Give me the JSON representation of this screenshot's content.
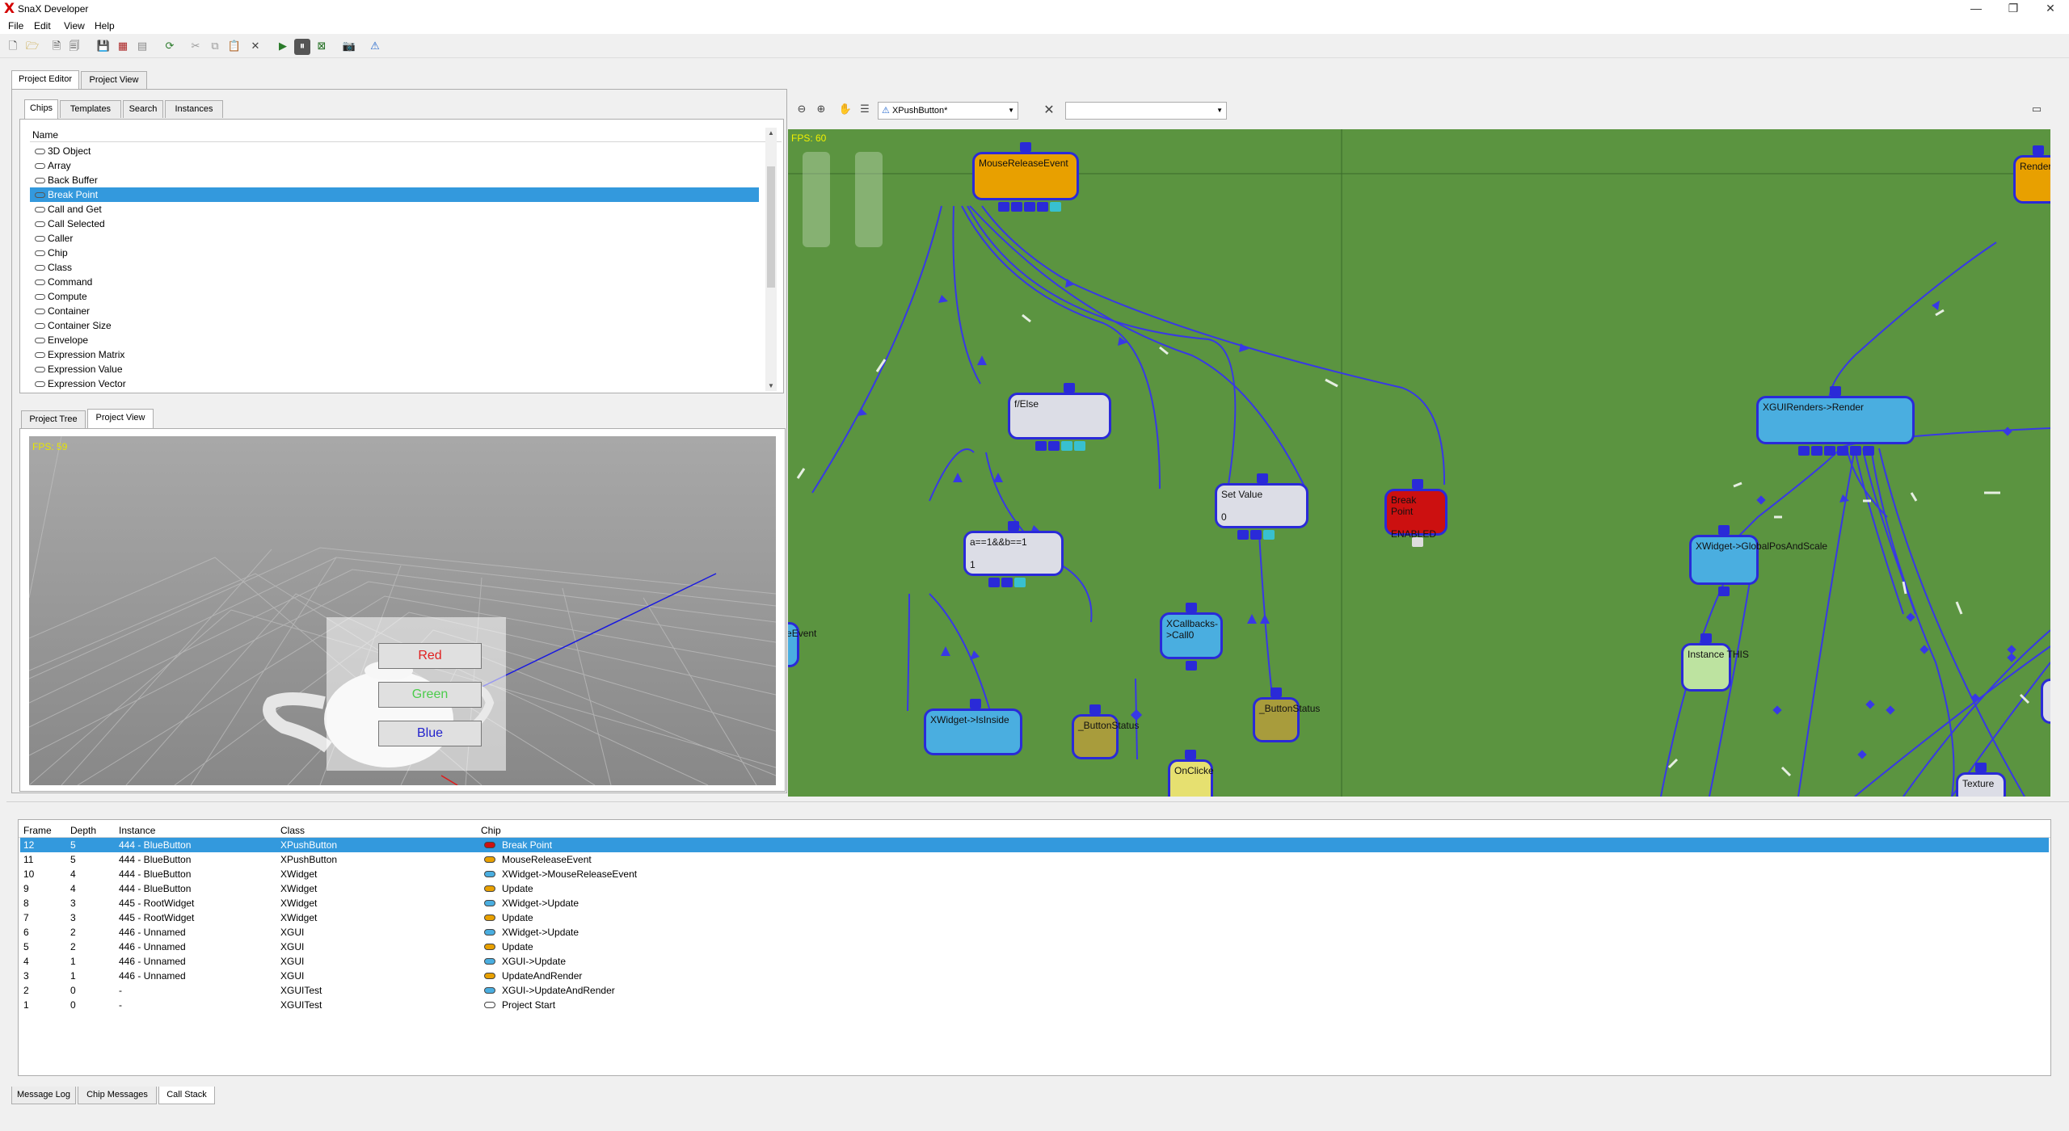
{
  "window": {
    "title": "SnaX Developer",
    "minimize": "—",
    "restore": "❐",
    "close": "✕"
  },
  "menu": [
    "File",
    "Edit",
    "View",
    "Help"
  ],
  "top_tabs": {
    "editor": "Project Editor",
    "view": "Project View"
  },
  "chips_tabs": [
    "Chips",
    "Templates",
    "Search",
    "Instances"
  ],
  "chips_list": {
    "header": "Name",
    "items": [
      "3D Object",
      "Array",
      "Back Buffer",
      "Break Point",
      "Call and Get",
      "Call Selected",
      "Caller",
      "Chip",
      "Class",
      "Command",
      "Compute",
      "Container",
      "Container Size",
      "Envelope",
      "Expression Matrix",
      "Expression Value",
      "Expression Vector"
    ],
    "selected": 3
  },
  "project_tabs": {
    "tree": "Project Tree",
    "view": "Project View"
  },
  "viewport": {
    "fps": "FPS: 59",
    "buttons": [
      {
        "label": "Red",
        "color": "#e02020"
      },
      {
        "label": "Green",
        "color": "#4ccc4c"
      },
      {
        "label": "Blue",
        "color": "#2222cc"
      }
    ]
  },
  "graph_toolbar": {
    "class_select": "XPushButton*",
    "second_select": ""
  },
  "graph": {
    "fps": "FPS: 60",
    "nodes": {
      "mre": "MouseReleaseEvent",
      "ifelse": "f/Else",
      "setvalue": "Set Value",
      "setvalue_val": "0",
      "bp": "Break Point",
      "bp_val": "ENABLED",
      "expr": "a==1&&b==1",
      "expr_val": "1",
      "callbacks": "XCallbacks->Call0",
      "isinside": "XWidget->IsInside",
      "bstatus1": "_ButtonStatus",
      "bstatus2": "_ButtonStatus",
      "onclicked": "OnClicke",
      "leftcut": "seReleaseEvent",
      "xguirender": "XGUIRenders->Render",
      "globalpos": "XWidget->GlobalPosAndScale",
      "instance": "Instance",
      "this": "THIS",
      "texture": "Texture",
      "render": "Render"
    }
  },
  "callstack": {
    "columns": [
      "Frame",
      "Depth",
      "Instance",
      "Class",
      "Chip"
    ],
    "rows": [
      {
        "frame": "12",
        "depth": "5",
        "instance": "444 - BlueButton",
        "class": "XPushButton",
        "chip": "Break Point",
        "icon": "red"
      },
      {
        "frame": "11",
        "depth": "5",
        "instance": "444 - BlueButton",
        "class": "XPushButton",
        "chip": "MouseReleaseEvent",
        "icon": "orange"
      },
      {
        "frame": "10",
        "depth": "4",
        "instance": "444 - BlueButton",
        "class": "XWidget",
        "chip": "XWidget->MouseReleaseEvent",
        "icon": "blue"
      },
      {
        "frame": "9",
        "depth": "4",
        "instance": "444 - BlueButton",
        "class": "XWidget",
        "chip": "Update",
        "icon": "orange"
      },
      {
        "frame": "8",
        "depth": "3",
        "instance": "445 - RootWidget",
        "class": "XWidget",
        "chip": "XWidget->Update",
        "icon": "blue"
      },
      {
        "frame": "7",
        "depth": "3",
        "instance": "445 - RootWidget",
        "class": "XWidget",
        "chip": "Update",
        "icon": "orange"
      },
      {
        "frame": "6",
        "depth": "2",
        "instance": "446 - Unnamed",
        "class": "XGUI",
        "chip": "XWidget->Update",
        "icon": "blue"
      },
      {
        "frame": "5",
        "depth": "2",
        "instance": "446 - Unnamed",
        "class": "XGUI",
        "chip": "Update",
        "icon": "orange"
      },
      {
        "frame": "4",
        "depth": "1",
        "instance": "446 - Unnamed",
        "class": "XGUI",
        "chip": "XGUI->Update",
        "icon": "blue"
      },
      {
        "frame": "3",
        "depth": "1",
        "instance": "446 - Unnamed",
        "class": "XGUI",
        "chip": "UpdateAndRender",
        "icon": "orange"
      },
      {
        "frame": "2",
        "depth": "0",
        "instance": "-",
        "class": "XGUITest",
        "chip": "XGUI->UpdateAndRender",
        "icon": "blue"
      },
      {
        "frame": "1",
        "depth": "0",
        "instance": "-",
        "class": "XGUITest",
        "chip": "Project Start",
        "icon": "white"
      }
    ],
    "selected": 0
  },
  "bottom_tabs": [
    "Message Log",
    "Chip Messages",
    "Call Stack"
  ],
  "colors": {
    "selection": "#3399dd",
    "graph_bg": "#5b9440",
    "node_border": "#2a2ad8",
    "orange_node": "#e8a000",
    "blue_node": "#4aaee0",
    "red_node": "#cc1010"
  }
}
